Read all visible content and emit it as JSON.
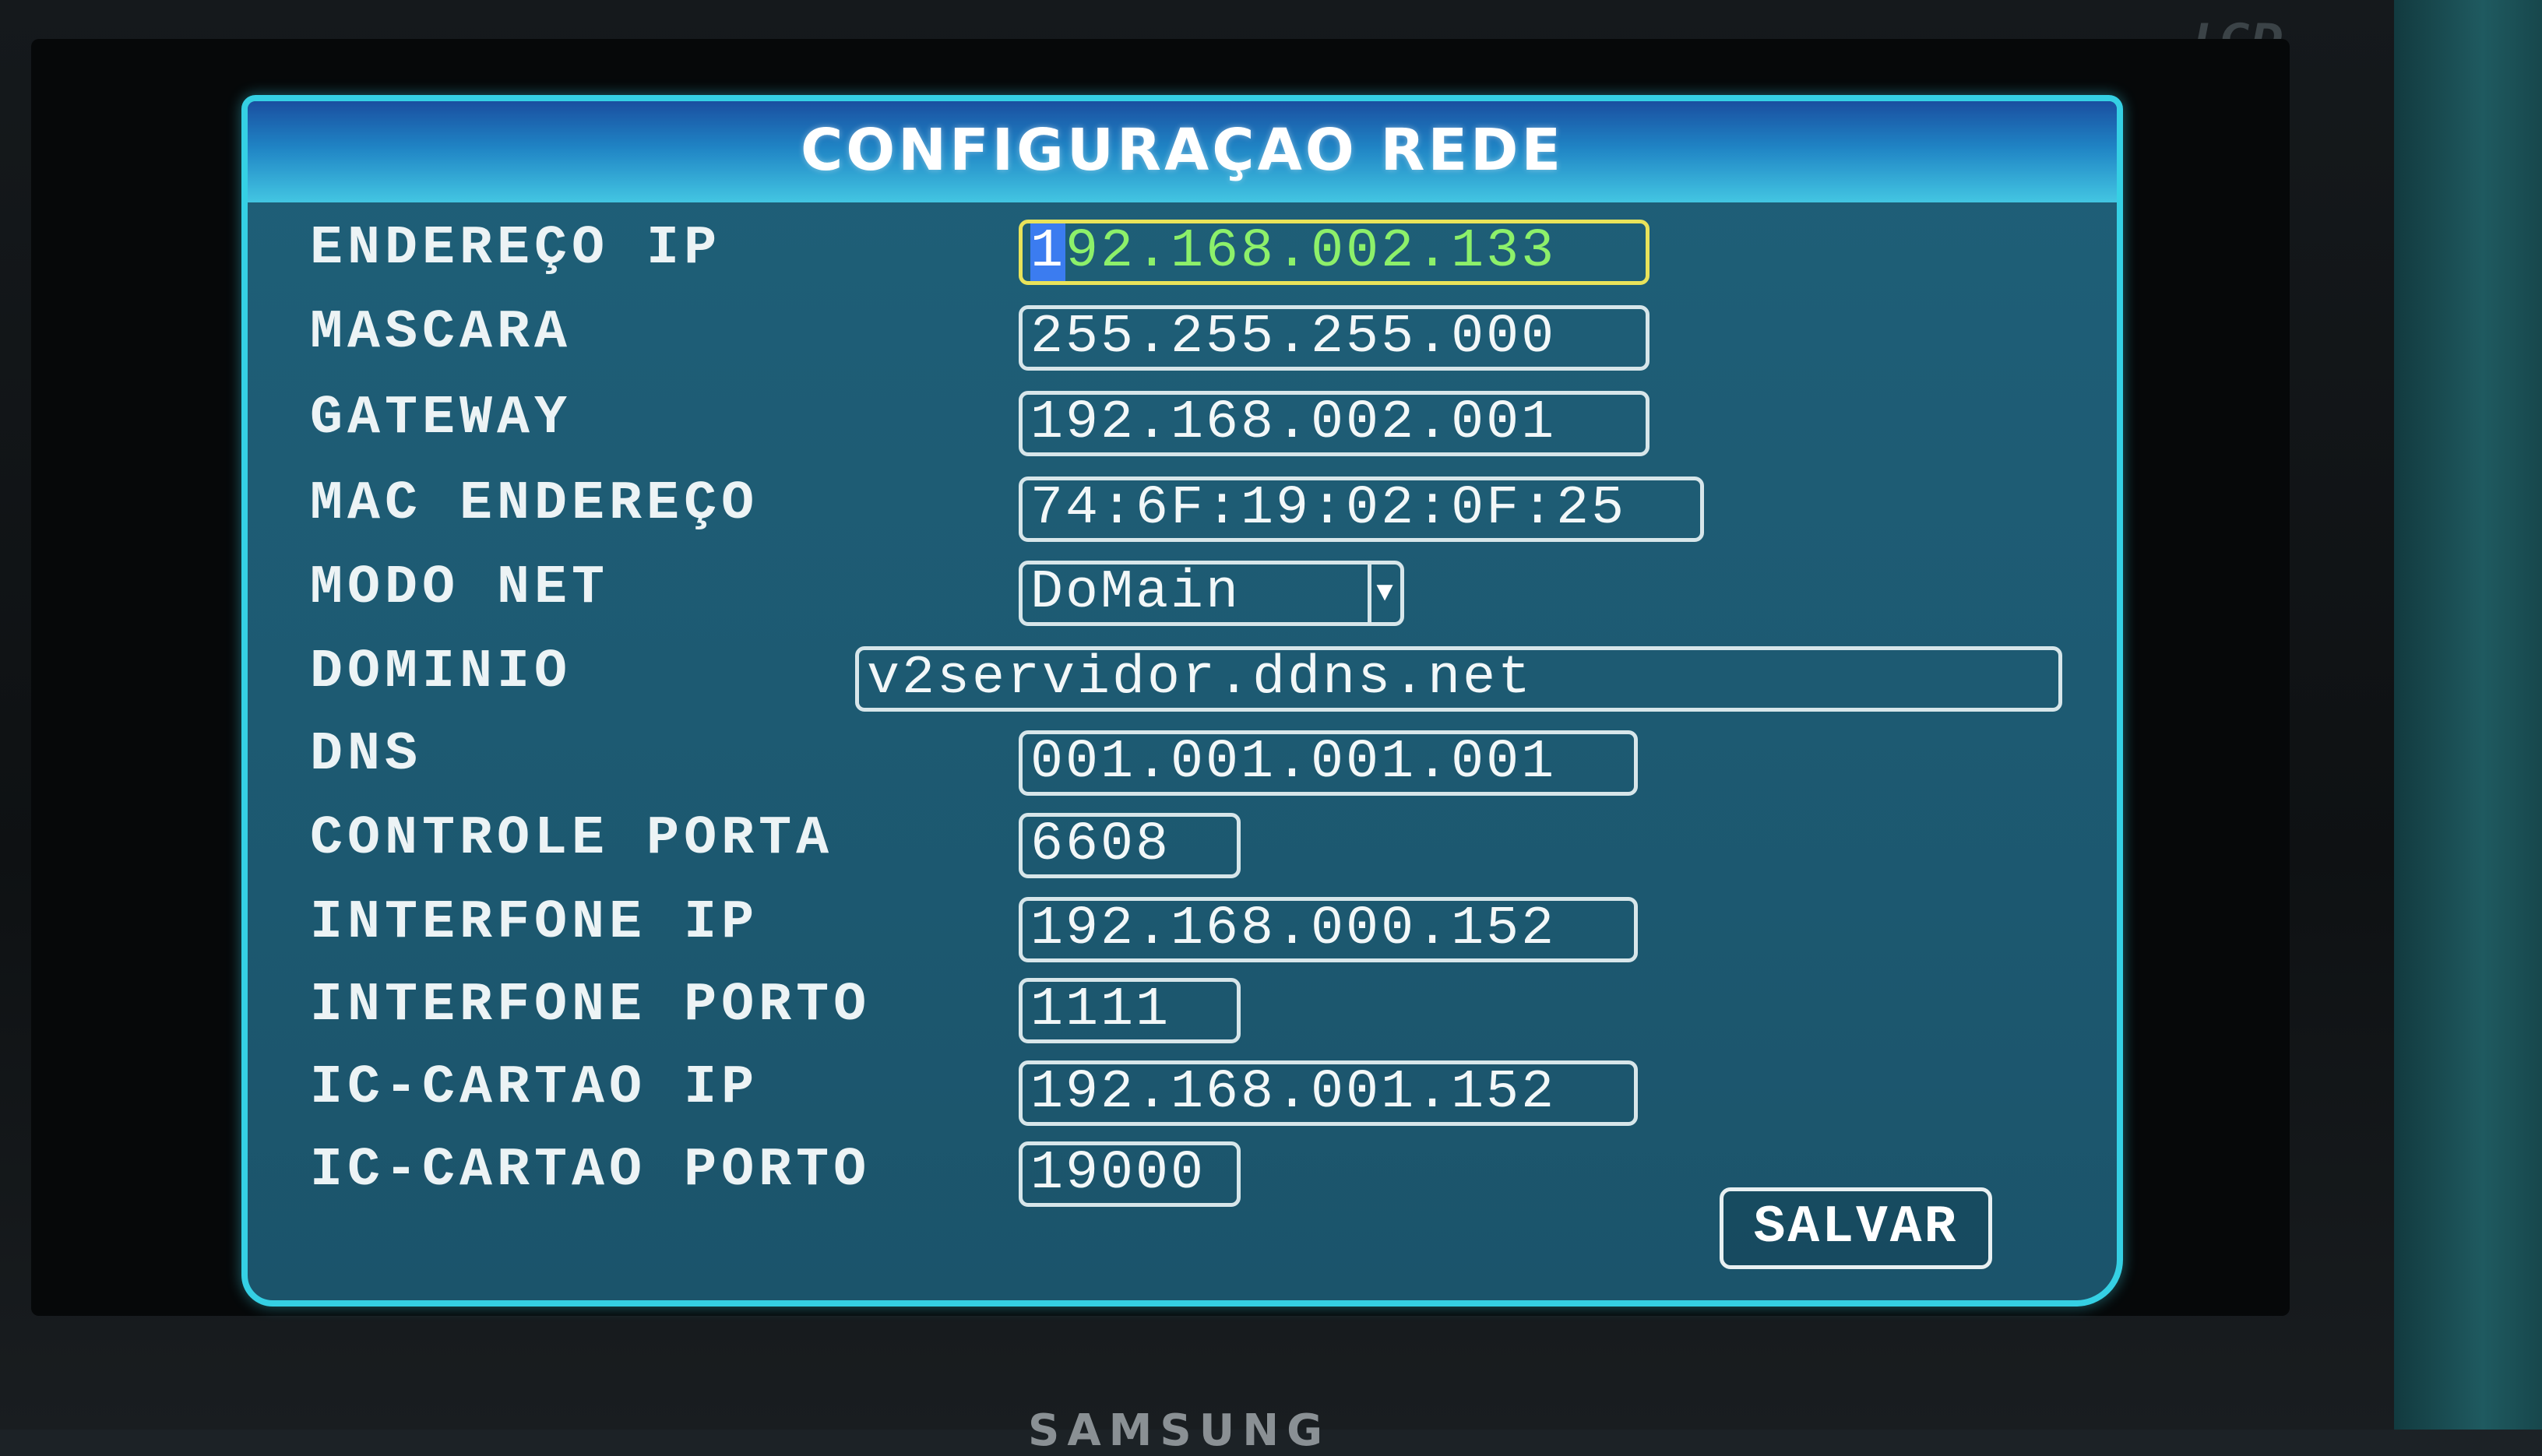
{
  "window": {
    "title": "CONFIGURAÇAO REDE"
  },
  "fields": [
    {
      "label": "ENDEREÇO IP",
      "value": "192.168.002.133",
      "cursor_char": "1",
      "rest": "92.168.002.133",
      "active": true
    },
    {
      "label": "MASCARA",
      "value": "255.255.255.000"
    },
    {
      "label": "GATEWAY",
      "value": "192.168.002.001"
    },
    {
      "label": "MAC ENDEREÇO",
      "value": "74:6F:19:02:0F:25"
    },
    {
      "label": "MODO NET",
      "value": "DoMain",
      "type": "dropdown"
    },
    {
      "label": "DOMINIO",
      "value": "v2servidor.ddns.net"
    },
    {
      "label": "DNS",
      "value": "001.001.001.001"
    },
    {
      "label": "CONTROLE PORTA",
      "value": "6608"
    },
    {
      "label": "INTERFONE IP",
      "value": "192.168.000.152"
    },
    {
      "label": "INTERFONE PORTO",
      "value": "1111"
    },
    {
      "label": "IC-CARTAO IP",
      "value": "192.168.001.152"
    },
    {
      "label": "IC-CARTAO PORTO",
      "value": "19000"
    }
  ],
  "actions": {
    "save_label": "SALVAR"
  },
  "monitor": {
    "brand_top": "LCD",
    "brand_bottom": "SAMSUNG"
  },
  "colors": {
    "accent": "#35d0e4",
    "panel": "#1d5a72",
    "active_border": "#e9e35a",
    "active_text": "#8df06a",
    "cursor": "#3b7cf0"
  }
}
